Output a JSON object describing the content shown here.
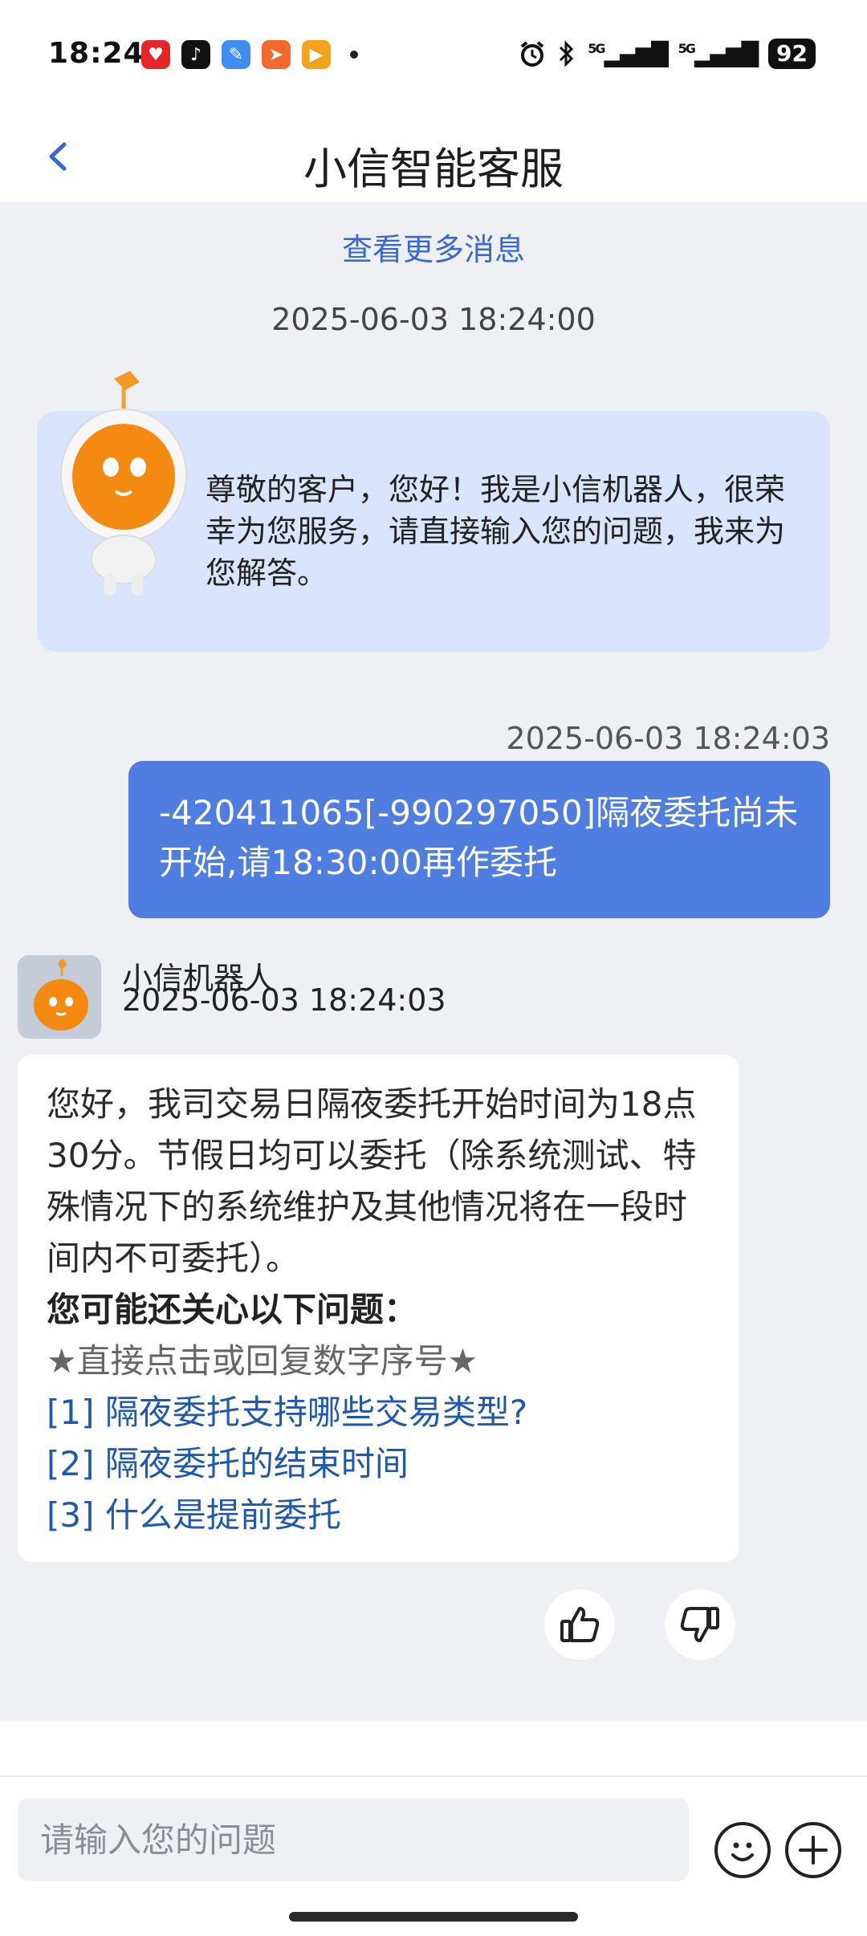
{
  "status_bar": {
    "time": "18:24",
    "network1": "5G",
    "network2": "5G",
    "battery": "92",
    "app_icons": [
      "pinduoduo-icon",
      "tiktok-icon",
      "feather-icon",
      "send-icon",
      "video-icon"
    ]
  },
  "header": {
    "title": "小信智能客服"
  },
  "chat": {
    "more_link": "查看更多消息",
    "welcome_timestamp": "2025-06-03 18:24:00",
    "welcome_text": "尊敬的客户，您好！我是小信机器人，很荣幸为您服务，请直接输入您的问题，我来为您解答。",
    "user_timestamp": "2025-06-03 18:24:03",
    "user_message": "-420411065[-990297050]隔夜委托尚未开始,请18:30:00再作委托",
    "bot_name": "小信机器人",
    "bot_timestamp": "2025-06-03 18:24:03",
    "bot_reply": "您好，我司交易日隔夜委托开始时间为18点30分。节假日均可以委托（除系统测试、特殊情况下的系统维护及其他情况将在一段时间内不可委托）。",
    "related_title": "您可能还关心以下问题：",
    "related_hint": "★直接点击或回复数字序号★",
    "related_questions": [
      "[1] 隔夜委托支持哪些交易类型?",
      "[2] 隔夜委托的结束时间",
      "[3] 什么是提前委托"
    ]
  },
  "input": {
    "placeholder": "请输入您的问题"
  },
  "colors": {
    "accent": "#4f7ee0",
    "link": "#1f58b0",
    "welcome_bg": "#d9e4fd",
    "chat_bg": "#eef0f4"
  }
}
